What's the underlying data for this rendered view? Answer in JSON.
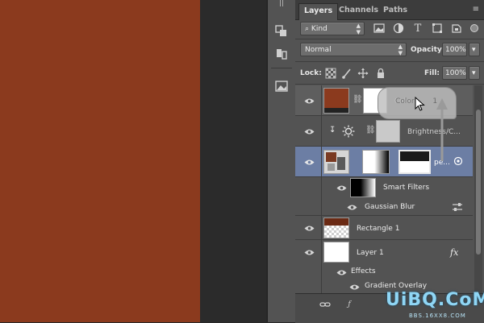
{
  "canvas": {
    "color": "#8b3a1e"
  },
  "tabs": [
    {
      "label": "Layers",
      "active": true
    },
    {
      "label": "Channels",
      "active": false
    },
    {
      "label": "Paths",
      "active": false
    }
  ],
  "filter": {
    "kind_label": "Kind"
  },
  "blend": {
    "mode": "Normal",
    "opacity_label": "Opacity:",
    "opacity_value": "100%"
  },
  "lock": {
    "label": "Lock:",
    "fill_label": "Fill:",
    "fill_value": "100%"
  },
  "layers": [
    {
      "name": "Color Fill 1",
      "name_visible": "Color",
      "suffix": "1"
    },
    {
      "name": "Brightness/C..."
    },
    {
      "name": "pe...",
      "selected": true
    },
    {
      "name": "Smart Filters"
    },
    {
      "name": "Gaussian Blur"
    },
    {
      "name": "Rectangle 1"
    },
    {
      "name": "Layer 1",
      "fx": "fx"
    },
    {
      "name": "Effects"
    },
    {
      "name": "Gradient Overlay"
    }
  ],
  "watermark": {
    "main": "UiBQ.CoM",
    "sub": "BBS.16XX8.COM"
  }
}
